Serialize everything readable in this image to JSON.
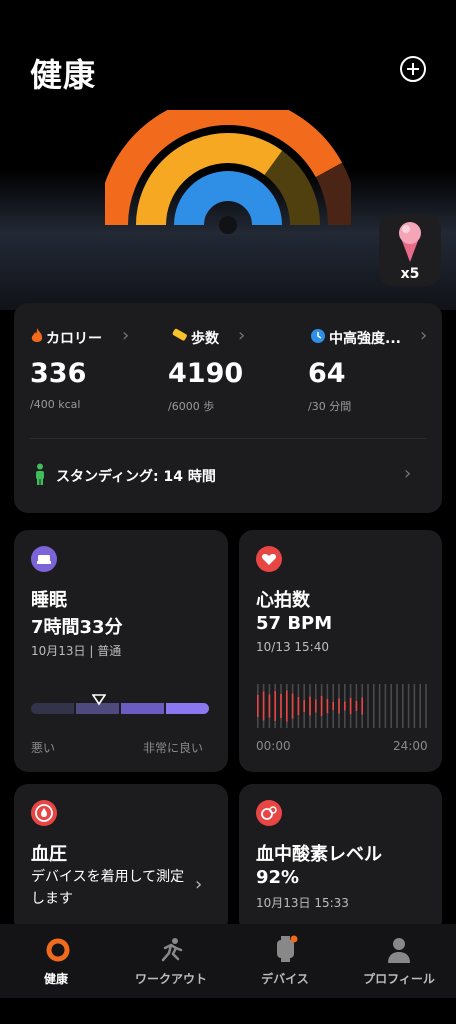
{
  "header": {
    "title": "健康"
  },
  "rings": {
    "calorie_pct": 0.84,
    "steps_pct": 0.7,
    "intensity_pct": 1.0
  },
  "badge": {
    "count": "x5"
  },
  "activity": {
    "calories": {
      "label": "カロリー",
      "value": "336",
      "target": "/400 kcal"
    },
    "steps": {
      "label": "歩数",
      "value": "4190",
      "target": "/6000 歩"
    },
    "intensity": {
      "label": "中高強度...",
      "value": "64",
      "target": "/30 分間"
    },
    "standing": "スタンディング: 14 時間"
  },
  "sleep": {
    "title": "睡眠",
    "duration": "7時間33分",
    "subtitle": "10月13日 | 普通",
    "quality_pct": 0.38,
    "left_label": "悪い",
    "right_label": "非常に良い"
  },
  "heart": {
    "title": "心拍数",
    "value": "57 BPM",
    "time": "10/13 15:40",
    "axis_start": "00:00",
    "axis_end": "24:00"
  },
  "bp": {
    "title": "血圧",
    "message": "デバイスを着用して測定します"
  },
  "spo2": {
    "title": "血中酸素レベル",
    "value": "92%",
    "time": "10月13日 15:33"
  },
  "nav": {
    "health": "健康",
    "workout": "ワークアウト",
    "devices": "デバイス",
    "profile": "プロフィール"
  },
  "colors": {
    "calorie": "#f26a1b",
    "steps": "#f7a823",
    "intensity": "#2f8ee6",
    "heart": "#e84545",
    "sleep": "#7b63d8"
  }
}
